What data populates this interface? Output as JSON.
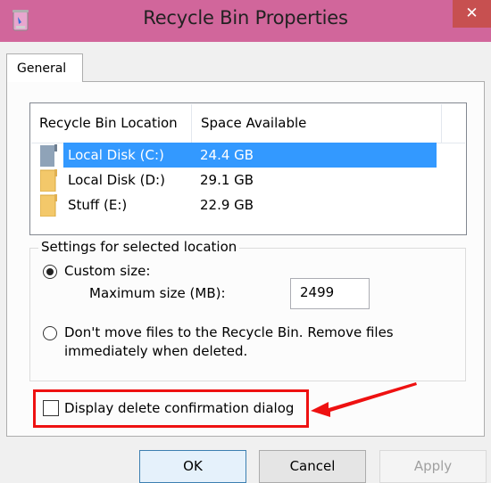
{
  "window": {
    "title": "Recycle Bin Properties",
    "app_icon": "recycle-bin-icon",
    "close_icon": "close-icon",
    "close_glyph": "✕",
    "titlebar_color": "#D1669B",
    "close_color": "#C75050"
  },
  "tabs": [
    {
      "label": "General",
      "active": true
    }
  ],
  "locations": {
    "columns": [
      "Recycle Bin Location",
      "Space Available"
    ],
    "rows": [
      {
        "name": "Local Disk (C:)",
        "space": "24.4 GB",
        "icon": "system-drive-icon",
        "selected": true
      },
      {
        "name": "Local Disk (D:)",
        "space": "29.1 GB",
        "icon": "drive-folder-icon",
        "selected": false
      },
      {
        "name": "Stuff (E:)",
        "space": "22.9 GB",
        "icon": "drive-folder-icon",
        "selected": false
      }
    ],
    "selection_color": "#3399FF"
  },
  "settings": {
    "group_label": "Settings for selected location",
    "custom_size_label": "Custom size:",
    "custom_size_selected": true,
    "max_size_label": "Maximum size (MB):",
    "max_size_value": "2499",
    "dont_move_label_line1": "Don't move files to the Recycle Bin. Remove files",
    "dont_move_label_line2": "immediately when deleted.",
    "dont_move_selected": false
  },
  "confirmation": {
    "label": "Display delete confirmation dialog",
    "checked": false,
    "annotation_color": "#EE1111"
  },
  "buttons": {
    "ok": "OK",
    "cancel": "Cancel",
    "apply": "Apply",
    "apply_enabled": false
  }
}
